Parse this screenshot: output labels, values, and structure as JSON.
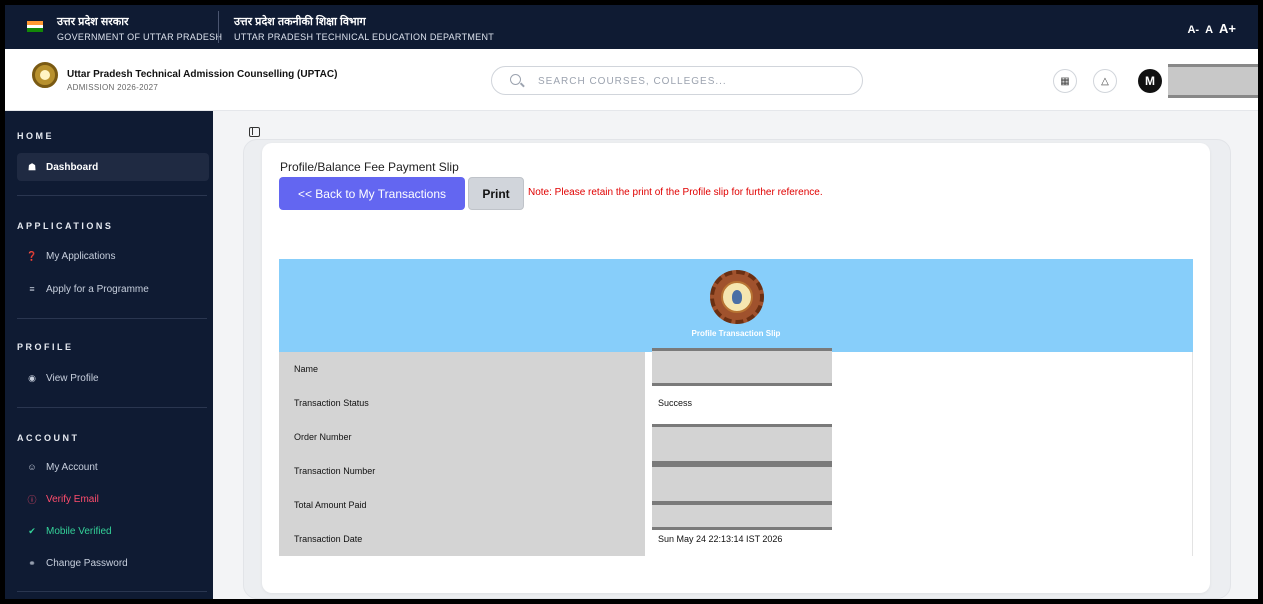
{
  "gov_bar": {
    "state_hi": "उत्तर प्रदेश सरकार",
    "state_en": "GOVERNMENT OF UTTAR PRADESH",
    "dept_hi": "उत्तर प्रदेश तकनीकी शिक्षा विभाग",
    "dept_en": "UTTAR PRADESH TECHNICAL EDUCATION DEPARTMENT",
    "font_controls": [
      "A-",
      "A",
      "A+"
    ]
  },
  "header": {
    "app_name": "Uttar Pradesh Technical Admission Counselling (UPTAC)",
    "app_sub": "ADMISSION 2026-2027",
    "search_placeholder": "SEARCH COURSES, COLLEGES...",
    "avatar_letter": "M",
    "icons": [
      "apps-icon",
      "bell-icon"
    ]
  },
  "sidebar": {
    "home_title": "HOME",
    "dashboard": "Dashboard",
    "applications_title": "APPLICATIONS",
    "my_applications": "My Applications",
    "apply_programme": "Apply for a Programme",
    "profile_title": "PROFILE",
    "view_profile": "View Profile",
    "account_title": "ACCOUNT",
    "my_account": "My Account",
    "verify_email": "Verify Email",
    "mobile_verified": "Mobile Verified",
    "change_password": "Change Password"
  },
  "main": {
    "page_title": "Profile/Balance Fee Payment Slip",
    "back_label": "<< Back to My Transactions",
    "print_label": "Print",
    "note": "Note: Please retain the print of the Profile slip for further reference.",
    "slip_title": "Profile Transaction Slip",
    "rows": [
      {
        "label": "Name",
        "value": ""
      },
      {
        "label": "Transaction Status",
        "value": "Success"
      },
      {
        "label": "Order Number",
        "value": ""
      },
      {
        "label": "Transaction Number",
        "value": ""
      },
      {
        "label": "Total Amount Paid",
        "value": ""
      },
      {
        "label": "Transaction Date",
        "value": "Sun May 24 22:13:14 IST 2026"
      }
    ]
  },
  "colors": {
    "navy": "#0f1b33",
    "primary": "#6366f1",
    "slip_header": "#87cefa",
    "warning": "#e00000"
  }
}
